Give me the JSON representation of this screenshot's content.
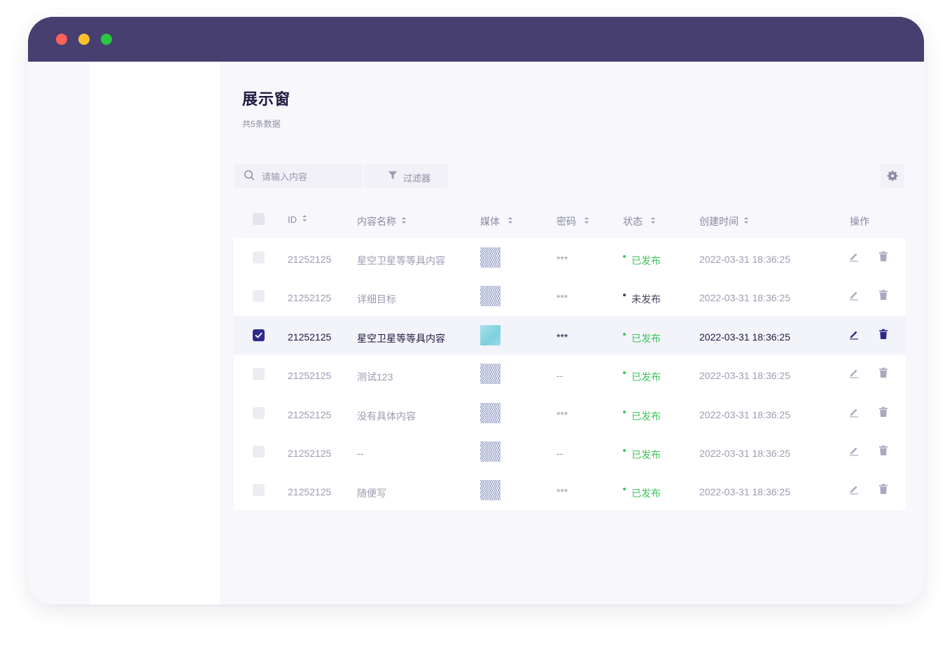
{
  "page": {
    "title": "展示窗",
    "subtitle": "共5条数据"
  },
  "toolbar": {
    "search_placeholder": "请输入内容",
    "filter_label": "过滤器"
  },
  "table": {
    "columns": {
      "id": "ID",
      "name": "内容名称",
      "media": "媒体",
      "password": "密码",
      "status": "状态",
      "created": "创建时间",
      "actions": "操作"
    },
    "rows": [
      {
        "id": "21252125",
        "name": "星空卫星等等具内容",
        "media": "pattern",
        "password": "***",
        "status": "已发布",
        "published": true,
        "created": "2022-03-31 18:36:25",
        "checked": false,
        "selected": false
      },
      {
        "id": "21252125",
        "name": "详细目标",
        "media": "pattern",
        "password": "***",
        "status": "未发布",
        "published": false,
        "created": "2022-03-31 18:36:25",
        "checked": false,
        "selected": false
      },
      {
        "id": "21252125",
        "name": "星空卫星等等具内容",
        "media": "photo",
        "password": "***",
        "status": "已发布",
        "published": true,
        "created": "2022-03-31 18:36:25",
        "checked": true,
        "selected": true
      },
      {
        "id": "21252125",
        "name": "测试123",
        "media": "pattern",
        "password": "--",
        "status": "已发布",
        "published": true,
        "created": "2022-03-31 18:36:25",
        "checked": false,
        "selected": false
      },
      {
        "id": "21252125",
        "name": "没有具体内容",
        "media": "pattern",
        "password": "***",
        "status": "已发布",
        "published": true,
        "created": "2022-03-31 18:36:25",
        "checked": false,
        "selected": false
      },
      {
        "id": "21252125",
        "name": "--",
        "media": "pattern",
        "password": "--",
        "status": "已发布",
        "published": true,
        "created": "2022-03-31 18:36:25",
        "checked": false,
        "selected": false
      },
      {
        "id": "21252125",
        "name": "随便写",
        "media": "pattern",
        "password": "***",
        "status": "已发布",
        "published": true,
        "created": "2022-03-31 18:36:25",
        "checked": false,
        "selected": false
      }
    ]
  },
  "icons": {
    "search": "search-icon",
    "filter": "filter-icon",
    "settings": "gear-icon",
    "edit": "pencil-icon",
    "delete": "trash-icon"
  },
  "colors": {
    "titlebar": "#463f70",
    "accent": "#2f2a8a",
    "published": "#3fc45e",
    "draft": "#44445e"
  }
}
